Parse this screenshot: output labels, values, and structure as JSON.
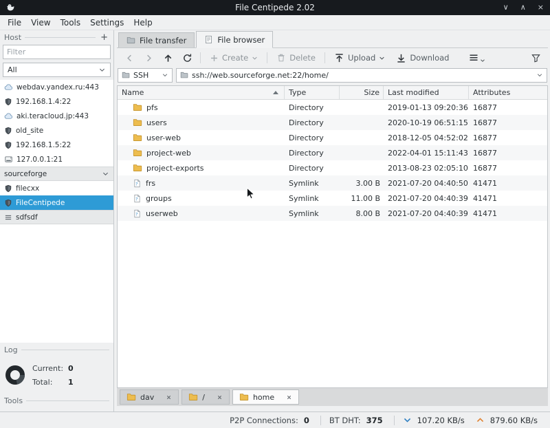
{
  "window": {
    "title": "File Centipede 2.02",
    "controls": {
      "minimize": "∨",
      "maximize": "∧",
      "close": "×"
    }
  },
  "menubar": {
    "items": [
      {
        "label": "File"
      },
      {
        "label": "View"
      },
      {
        "label": "Tools"
      },
      {
        "label": "Settings"
      },
      {
        "label": "Help"
      }
    ]
  },
  "sidebar": {
    "host": {
      "label": "Host",
      "add_button": "+"
    },
    "filter": {
      "placeholder": "Filter"
    },
    "scope_select": {
      "value": "All"
    },
    "hosts": [
      {
        "label": "webdav.yandex.ru:443",
        "icon": "cloud-icon"
      },
      {
        "label": "192.168.1.4:22",
        "icon": "shield-icon"
      },
      {
        "label": "aki.teracloud.jp:443",
        "icon": "cloud-icon"
      },
      {
        "label": "old_site",
        "icon": "shield-icon"
      },
      {
        "label": "192.168.1.5:22",
        "icon": "shield-icon"
      },
      {
        "label": "127.0.0.1:21",
        "icon": "drive-icon"
      }
    ],
    "groups": [
      {
        "label": "sourceforge",
        "collapsed": false,
        "items": [
          {
            "label": "filecxx",
            "icon": "shield-icon",
            "selected": false
          },
          {
            "label": "FileCentipede",
            "icon": "shield-icon",
            "selected": true
          }
        ]
      },
      {
        "label": "sdfsdf",
        "collapsed": true,
        "items": []
      }
    ],
    "log": {
      "label": "Log"
    },
    "stats": {
      "current_label": "Current:",
      "current_value": "0",
      "total_label": "Total:",
      "total_value": "1"
    },
    "tools": {
      "label": "Tools"
    }
  },
  "main": {
    "tabs": [
      {
        "label": "File transfer",
        "icon": "folder-tab-icon",
        "active": false
      },
      {
        "label": "File browser",
        "icon": "list-tab-icon",
        "active": true
      }
    ],
    "toolbar": {
      "create_label": "Create",
      "delete_label": "Delete",
      "upload_label": "Upload",
      "download_label": "Download"
    },
    "addressbar": {
      "protocol": "SSH",
      "path": "ssh://web.sourceforge.net:22/home/"
    },
    "file_table": {
      "columns": [
        {
          "label": "Name",
          "sorted": true
        },
        {
          "label": "Type"
        },
        {
          "label": "Size"
        },
        {
          "label": "Last modified"
        },
        {
          "label": "Attributes"
        }
      ],
      "rows": [
        {
          "name": "pfs",
          "icon": "folder-icon",
          "type": "Directory",
          "size": "",
          "modified": "2019-01-13 09:20:36",
          "attributes": "16877"
        },
        {
          "name": "users",
          "icon": "folder-icon",
          "type": "Directory",
          "size": "",
          "modified": "2020-10-19 06:51:15",
          "attributes": "16877"
        },
        {
          "name": "user-web",
          "icon": "folder-icon",
          "type": "Directory",
          "size": "",
          "modified": "2018-12-05 04:52:02",
          "attributes": "16877"
        },
        {
          "name": "project-web",
          "icon": "folder-icon",
          "type": "Directory",
          "size": "",
          "modified": "2022-04-01 15:11:43",
          "attributes": "16877"
        },
        {
          "name": "project-exports",
          "icon": "folder-icon",
          "type": "Directory",
          "size": "",
          "modified": "2013-08-23 02:05:10",
          "attributes": "16877"
        },
        {
          "name": "frs",
          "icon": "symlink-file-icon",
          "type": "Symlink",
          "size": "3.00 B",
          "modified": "2021-07-20 04:40:50",
          "attributes": "41471"
        },
        {
          "name": "groups",
          "icon": "symlink-file-icon",
          "type": "Symlink",
          "size": "11.00 B",
          "modified": "2021-07-20 04:40:39",
          "attributes": "41471"
        },
        {
          "name": "userweb",
          "icon": "symlink-file-icon",
          "type": "Symlink",
          "size": "8.00 B",
          "modified": "2021-07-20 04:40:39",
          "attributes": "41471"
        }
      ]
    },
    "session_tabs": [
      {
        "label": "dav",
        "icon": "folder-icon",
        "active": false
      },
      {
        "label": "/",
        "icon": "folder-icon",
        "active": false
      },
      {
        "label": "home",
        "icon": "folder-icon",
        "active": true
      }
    ]
  },
  "statusbar": {
    "p2p_label": "P2P Connections:",
    "p2p_value": "0",
    "dht_label": "BT DHT:",
    "dht_value": "375",
    "down_speed": "107.20 KB/s",
    "up_speed": "879.60 KB/s"
  },
  "colors": {
    "selection_blue": "#2e9bd6",
    "folder_yellow": "#edbd4f",
    "download_accent": "#2d7fc1",
    "upload_accent": "#e0812f"
  }
}
